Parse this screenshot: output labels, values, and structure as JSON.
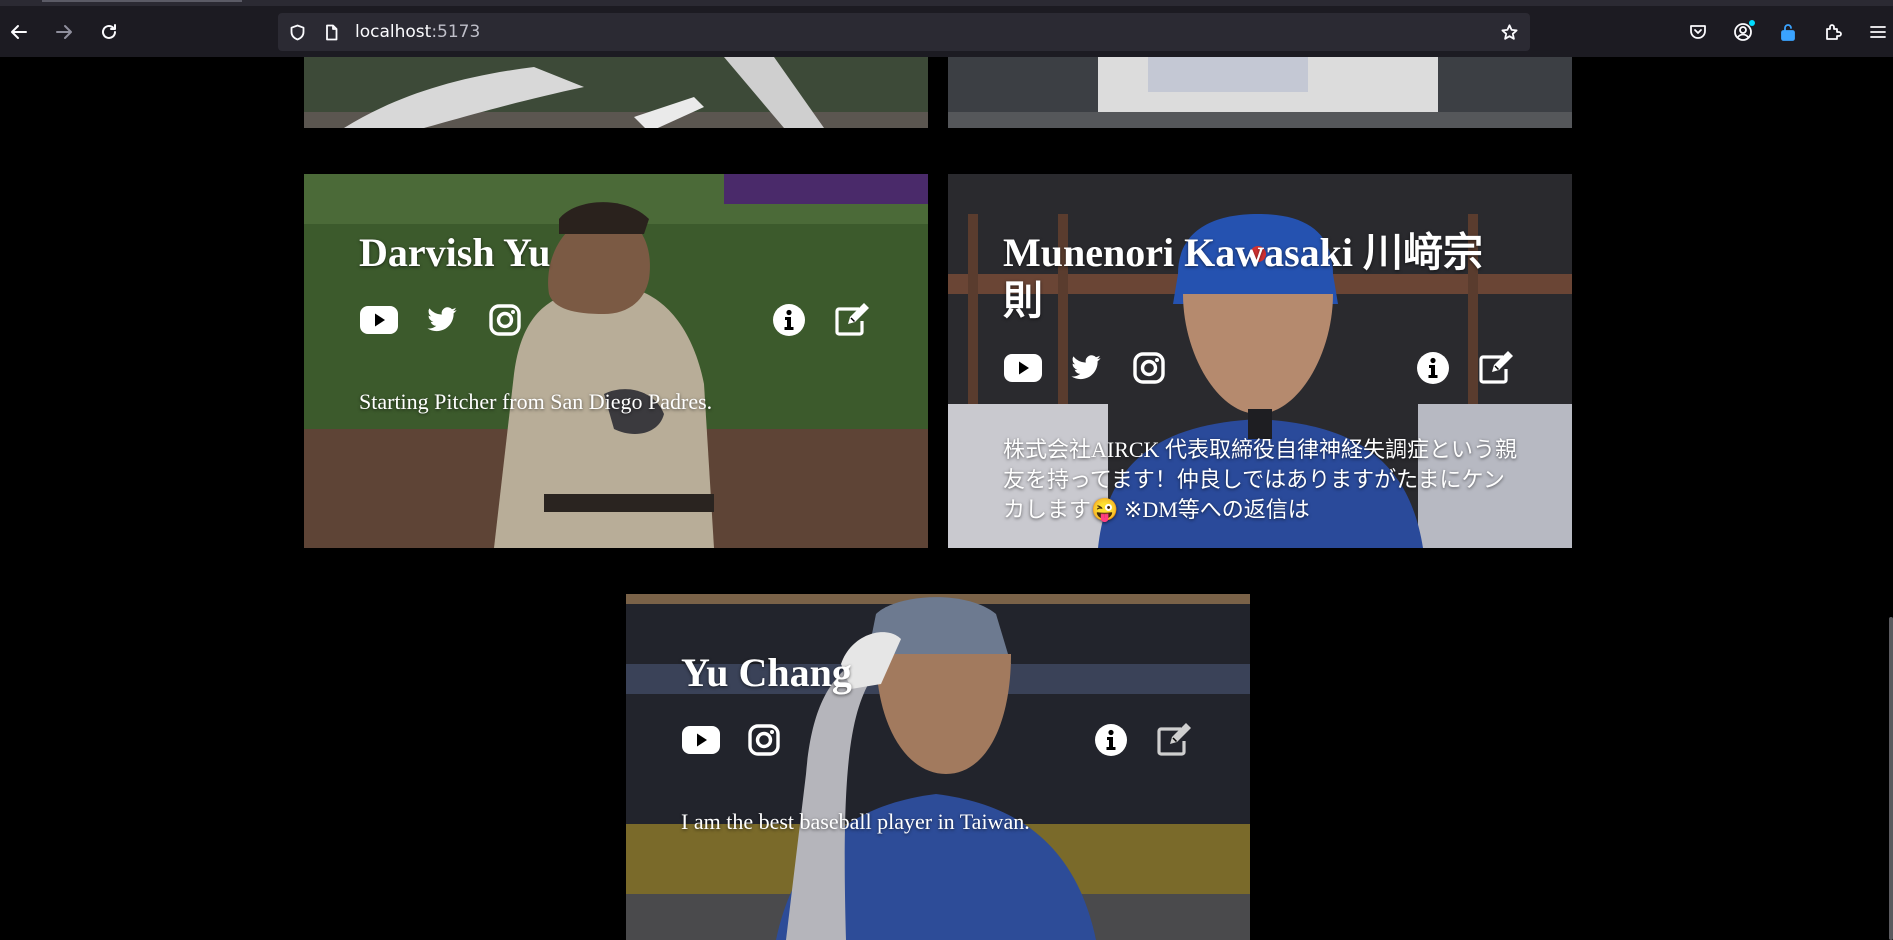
{
  "browser": {
    "url_host": "localhost",
    "url_port": ":5173",
    "back_icon": "back-arrow-icon",
    "forward_icon": "forward-arrow-icon",
    "reload_icon": "reload-icon"
  },
  "cards": [
    {
      "name": "Darvish Yu",
      "description": "Starting Pitcher from San Diego Padres.",
      "socials": [
        "youtube-icon",
        "twitter-icon",
        "instagram-icon"
      ],
      "actions": [
        "info-icon",
        "edit-icon"
      ]
    },
    {
      "name": "Munenori Kawasaki 川﨑宗則",
      "description": "株式会社AIRCK 代表取締役自律神経失調症という親友を持ってます！仲良しではありますがたまにケンカします😜 ※DM等への返信は",
      "socials": [
        "youtube-icon",
        "twitter-icon",
        "instagram-icon"
      ],
      "actions": [
        "info-icon",
        "edit-icon"
      ]
    },
    {
      "name": "Yu Chang",
      "description": "I am the best baseball player in Taiwan.",
      "socials": [
        "youtube-icon",
        "instagram-icon"
      ],
      "actions": [
        "info-icon",
        "edit-icon"
      ]
    }
  ]
}
